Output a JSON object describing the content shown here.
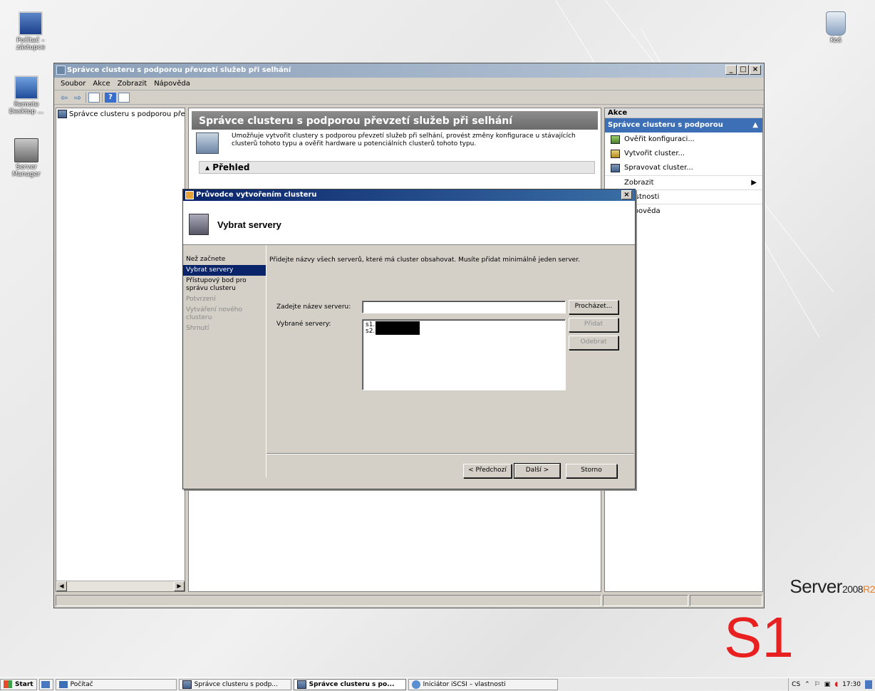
{
  "desktop": {
    "icons": [
      {
        "label": "Počítač – zástupce",
        "icon": "computer-icon"
      },
      {
        "label": "Remote Desktop ...",
        "icon": "remote-desktop-icon"
      },
      {
        "label": "Server Manager",
        "icon": "server-manager-icon"
      },
      {
        "label": "Koš",
        "icon": "recycle-bin-icon"
      }
    ],
    "brand": "Server",
    "brand_year": "2008",
    "brand_edition": "R2",
    "overlay_label": "S1"
  },
  "window": {
    "title": "Správce clusteru s podporou převzetí služeb při selhání",
    "controls": [
      "_",
      "□",
      "×"
    ],
    "menu": [
      "Soubor",
      "Akce",
      "Zobrazit",
      "Nápověda"
    ],
    "tree_item": "Správce clusteru s podporou přev:",
    "center_heading": "Správce clusteru s podporou převzetí služeb při selhání",
    "center_description": "Umožňuje vytvořit clustery s podporou převzetí služeb při selhání, provést změny konfigurace u stávajících clusterů tohoto typu a ověřit hardware u potenciálních clusterů tohoto typu.",
    "overview_label": "Přehled"
  },
  "actions": {
    "header": "Akce",
    "subheader": "Správce clusteru s podporou převz...",
    "items": [
      {
        "label": "Ověřit konfiguraci...",
        "icon": "validate-icon"
      },
      {
        "label": "Vytvořit cluster...",
        "icon": "create-cluster-icon"
      },
      {
        "label": "Spravovat cluster...",
        "icon": "manage-cluster-icon"
      },
      {
        "label": "Zobrazit",
        "icon": ""
      },
      {
        "label": "Vlastnosti",
        "icon": ""
      },
      {
        "label": "Nápověda",
        "icon": ""
      }
    ]
  },
  "wizard": {
    "title": "Průvodce vytvořením clusteru",
    "heading": "Vybrat servery",
    "steps": [
      {
        "label": "Než začnete",
        "state": "normal"
      },
      {
        "label": "Vybrat servery",
        "state": "active"
      },
      {
        "label": "Přístupový bod pro správu clusteru",
        "state": "normal"
      },
      {
        "label": "Potvrzení",
        "state": "disabled"
      },
      {
        "label": "Vytváření nového clusteru",
        "state": "disabled"
      },
      {
        "label": "Shrnutí",
        "state": "disabled"
      }
    ],
    "intro": "Přidejte názvy všech serverů, které má cluster obsahovat. Musíte přidat minimálně jeden server.",
    "server_name_label": "Zadejte název serveru:",
    "server_name_value": "",
    "selected_label": "Vybrané servery:",
    "selected_servers": [
      "s1.",
      "s2."
    ],
    "buttons": {
      "browse": "Procházet...",
      "add": "Přidat",
      "remove": "Odebrat",
      "prev": "< Předchozí",
      "next": "Další >",
      "cancel": "Storno"
    }
  },
  "taskbar": {
    "start": "Start",
    "items": [
      {
        "label": "Počítač",
        "active": false
      },
      {
        "label": "Správce clusteru s podp...",
        "active": false
      },
      {
        "label": "Správce clusteru s po...",
        "active": true
      },
      {
        "label": "Iniciátor iSCSI – vlastnosti",
        "active": false
      }
    ],
    "lang": "CS",
    "clock": "17:30"
  },
  "colors": {
    "accent": "#0a246a",
    "action_header": "#3c6fb6",
    "overlay": "#e82020"
  }
}
